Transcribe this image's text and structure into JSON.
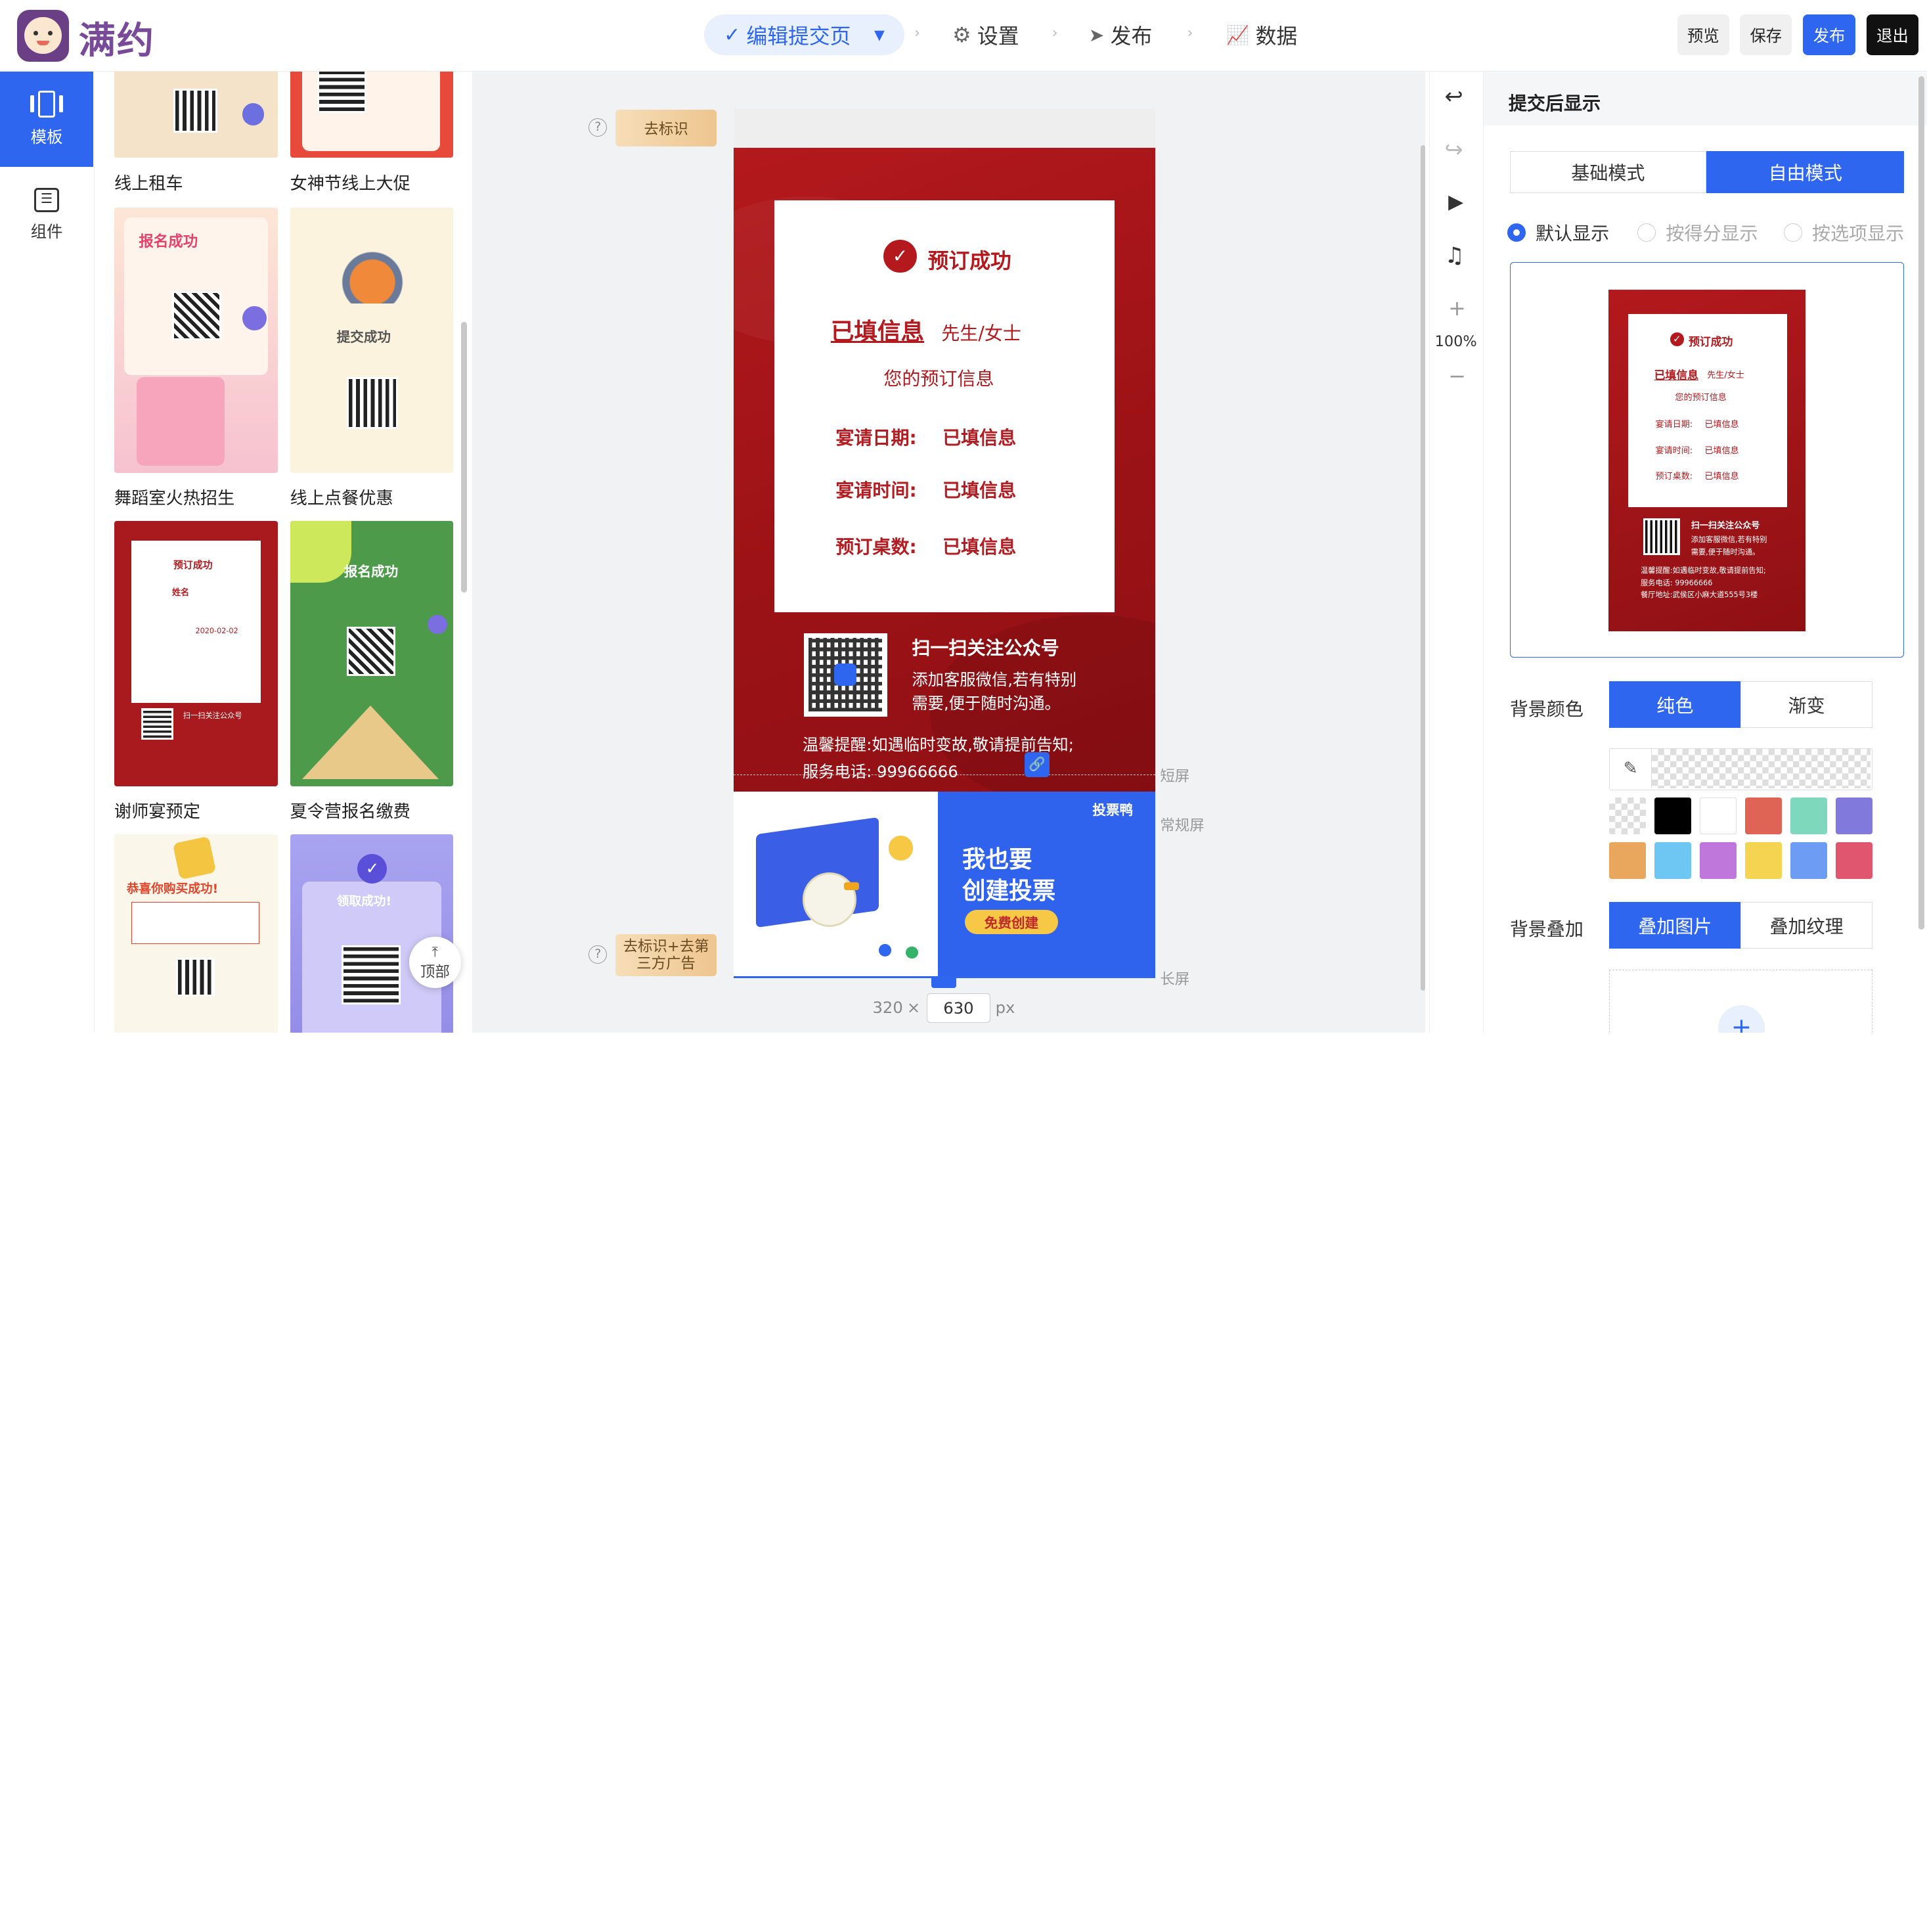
{
  "header": {
    "logo_text": "满约",
    "steps": [
      {
        "label": "编辑提交页",
        "icon": "check-circle-icon"
      },
      {
        "label": "设置",
        "icon": "gear-icon"
      },
      {
        "label": "发布",
        "icon": "send-icon"
      },
      {
        "label": "数据",
        "icon": "chart-icon"
      }
    ],
    "buttons": {
      "preview": "预览",
      "save": "保存",
      "publish": "发布",
      "exit": "退出"
    }
  },
  "rail": {
    "items": [
      {
        "label": "模板",
        "icon": "template-icon"
      },
      {
        "label": "组件",
        "icon": "component-icon"
      }
    ]
  },
  "templates": {
    "items": [
      {
        "name": "线上租车"
      },
      {
        "name": "女神节线上大促"
      },
      {
        "name": "舞蹈室火热招生"
      },
      {
        "name": "线上点餐优惠"
      },
      {
        "name": "谢师宴预定"
      },
      {
        "name": "夏令营报名缴费"
      },
      {
        "name": ""
      },
      {
        "name": ""
      }
    ],
    "top_button": "顶部",
    "thumb_text": {
      "signup_success": "报名成功",
      "submit_success": "提交成功",
      "booking_success": "预订成功",
      "name": "姓名",
      "sir_madam": "先生/女士",
      "date": "2020-02-02",
      "sign_success": "报名成功",
      "congrats": "恭喜你购买成功!",
      "claim": "领取成功!",
      "scan": "扫一扫关注公众号"
    }
  },
  "canvas": {
    "badge_remove_logo": "去标识",
    "badge_remove_logo_ad": "去标识+去第三方广告",
    "short_screen": "短屏",
    "normal_screen": "常规屏",
    "long_screen": "长屏",
    "width": "320",
    "times": "×",
    "height": "630",
    "unit": "px",
    "page": {
      "success_title": "预订成功",
      "filled_info": "已填信息",
      "sir_madam": "先生/女士",
      "your_info": "您的预订信息",
      "rows": [
        {
          "label": "宴请日期:",
          "value": "已填信息"
        },
        {
          "label": "宴请时间:",
          "value": "已填信息"
        },
        {
          "label": "预订桌数:",
          "value": "已填信息"
        }
      ],
      "scan_title": "扫一扫关注公众号",
      "scan_desc1": "添加客服微信,若有特别",
      "scan_desc2": "需要,便于随时沟通。",
      "tip": "温馨提醒:如遇临时变故,敬请提前告知;",
      "phone": "服务电话:  99966666"
    },
    "ad": {
      "brand": "投票鸭",
      "line1": "我也要",
      "line2": "创建投票",
      "cta": "免费创建"
    }
  },
  "tools": {
    "zoom": "100%"
  },
  "panel": {
    "title": "提交后显示",
    "modes": {
      "basic": "基础模式",
      "free": "自由模式"
    },
    "radios": {
      "default": "默认显示",
      "by_score": "按得分显示",
      "by_option": "按选项显示"
    },
    "preview": {
      "success": "预订成功",
      "filled": "已填信息",
      "sir": "先生/女士",
      "info": "您的预订信息",
      "rows": [
        {
          "label": "宴请日期:",
          "value": "已填信息"
        },
        {
          "label": "宴请时间:",
          "value": "已填信息"
        },
        {
          "label": "预订桌数:",
          "value": "已填信息"
        }
      ],
      "scan": "扫一扫关注公众号",
      "desc1": "添加客服微信,若有特别",
      "desc2": "需要,便于随时沟通。",
      "tip": "温馨提醒:如遇临时变故,敬请提前告知;",
      "phone": "服务电话:  99966666",
      "addr": "餐厅地址:武侯区小麻大道555号3楼"
    },
    "bg_color_label": "背景颜色",
    "bg_color_tabs": {
      "solid": "纯色",
      "gradient": "渐变"
    },
    "swatches": [
      "#000000",
      "#ffffff",
      "#e06456",
      "#7ed8bc",
      "#8179dc",
      "#e9a75e",
      "#6ec6f2",
      "#c077dc",
      "#f5d451",
      "#6c9cf3",
      "#e0566e"
    ],
    "bg_overlay_label": "背景叠加",
    "bg_overlay_tabs": {
      "image": "叠加图片",
      "texture": "叠加纹理"
    },
    "add": "+"
  },
  "colors": {
    "primary": "#2e66f0",
    "brand": "#7a4a9a",
    "red": "#b3191d"
  }
}
